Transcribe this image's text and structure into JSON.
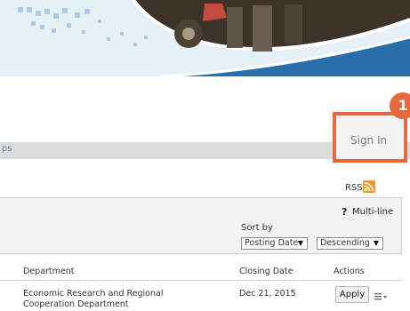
{
  "hero": {
    "image_alt": "People standing near a vehicle"
  },
  "header": {
    "signin_label": "Sign In",
    "step_number": "1",
    "nav_partial": "ps"
  },
  "feed": {
    "rss_label": "RSS:"
  },
  "filters": {
    "multiline_label": "Multi-line",
    "help_symbol": "?",
    "sort_by_label": "Sort by",
    "sort_field_value": "Posting Date",
    "sort_order_value": "Descending"
  },
  "table": {
    "columns": {
      "department": "Department",
      "closing_date": "Closing Date",
      "actions": "Actions"
    },
    "rows": [
      {
        "department": "Economic Research and Regional Cooperation Department",
        "closing_date": "Dec 21, 2015",
        "action_label": "Apply"
      }
    ]
  },
  "colors": {
    "accent": "#e5683f",
    "banner_blue": "#2b6fa8",
    "rss": "#f49a23"
  }
}
